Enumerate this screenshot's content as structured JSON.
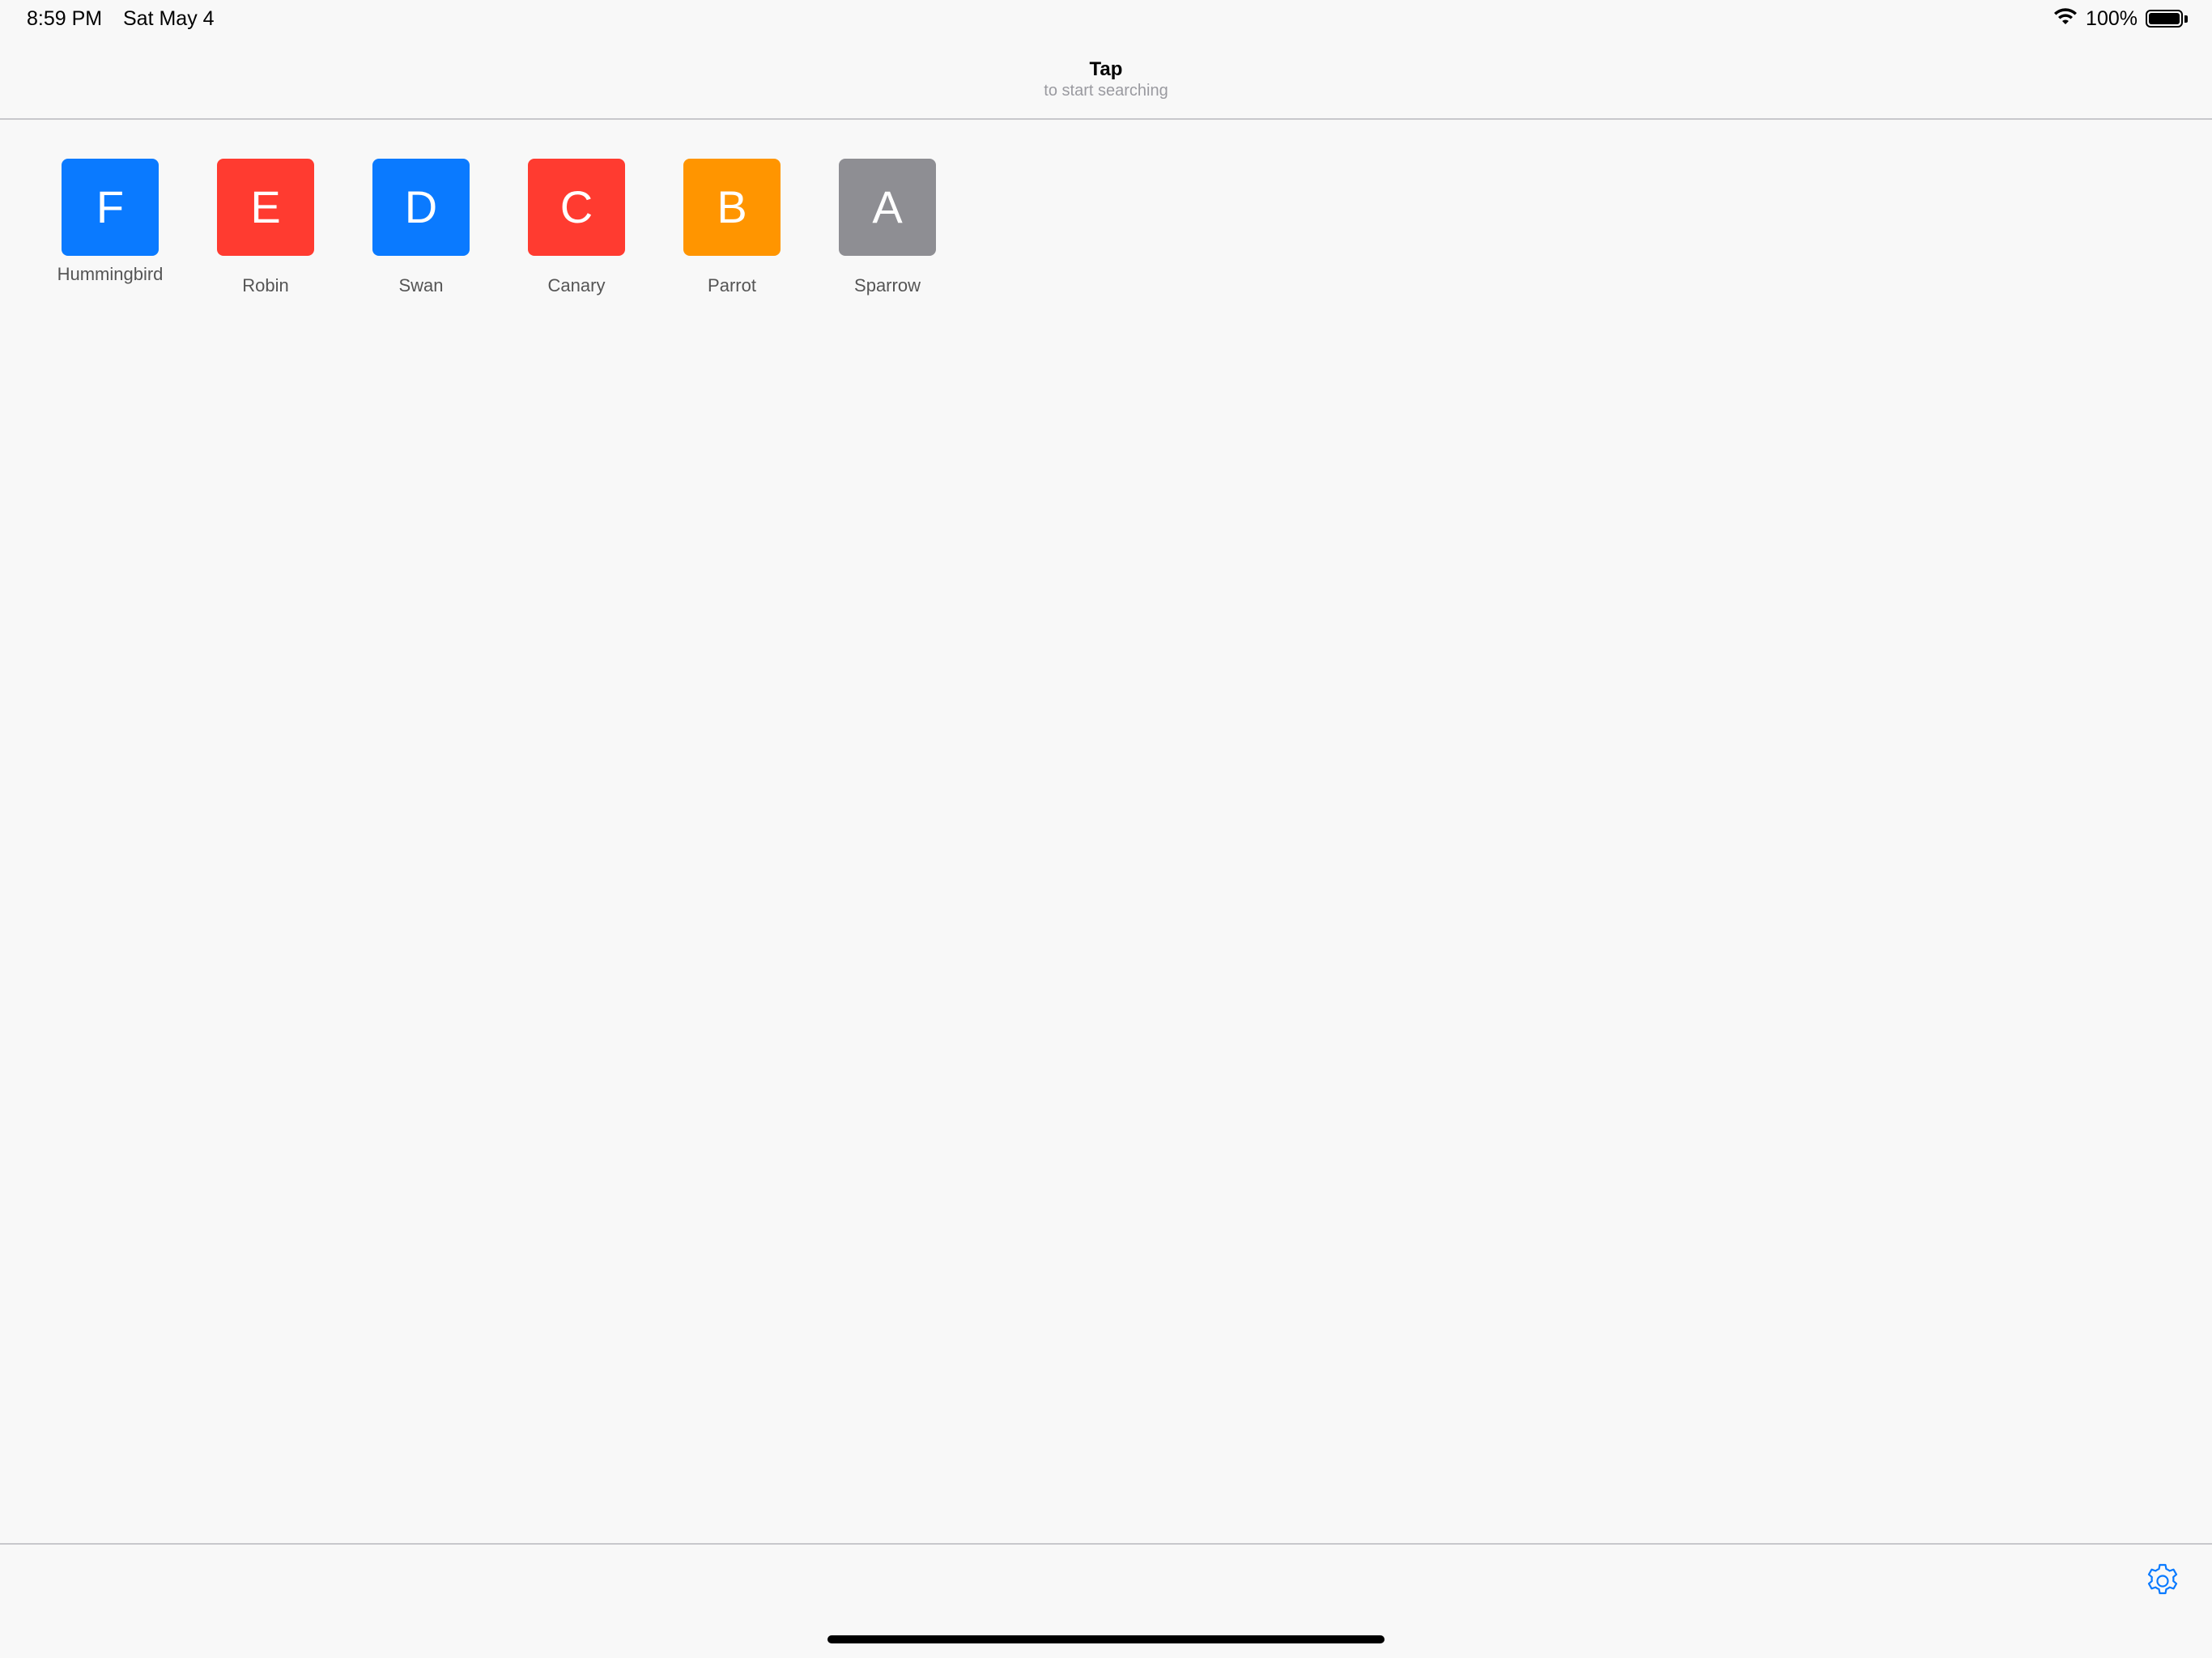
{
  "status_bar": {
    "time": "8:59 PM",
    "date": "Sat May 4",
    "battery_percent": "100%",
    "battery_level": 1.0,
    "icons": [
      "wifi-icon",
      "battery-icon"
    ]
  },
  "nav": {
    "title": "Tap",
    "subtitle": "to start searching"
  },
  "tiles": [
    {
      "letter": "F",
      "label": "Hummingbird",
      "color": "#0a7aff"
    },
    {
      "letter": "E",
      "label": "Robin",
      "color": "#ff3b30"
    },
    {
      "letter": "D",
      "label": "Swan",
      "color": "#0a7aff"
    },
    {
      "letter": "C",
      "label": "Canary",
      "color": "#ff3b30"
    },
    {
      "letter": "B",
      "label": "Parrot",
      "color": "#ff9500"
    },
    {
      "letter": "A",
      "label": "Sparrow",
      "color": "#8e8e93"
    }
  ],
  "toolbar": {
    "settings_icon": "gear-icon",
    "accent": "#0a7aff"
  }
}
